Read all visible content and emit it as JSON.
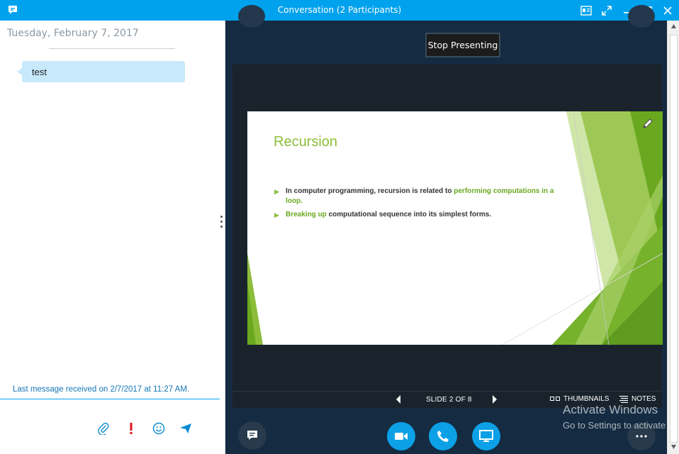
{
  "window": {
    "title": "Conversation (2 Participants)"
  },
  "conversation": {
    "date": "Tuesday, February 7, 2017",
    "messages": [
      {
        "text": "test"
      }
    ],
    "status": "Last message received on 2/7/2017 at 11:27 AM.",
    "compose_value": ""
  },
  "presentation": {
    "stop_label": "Stop Presenting",
    "slide": {
      "title": "Recursion",
      "bullets": [
        {
          "parts": [
            {
              "text": "In computer programming, recursion is related to ",
              "highlight": false
            },
            {
              "text": "performing computations in a loop",
              "highlight": true
            },
            {
              "text": ".",
              "highlight": false
            }
          ]
        },
        {
          "parts": [
            {
              "text": "Breaking up",
              "highlight": true
            },
            {
              "text": " computational sequence into its simplest forms.",
              "highlight": false
            }
          ]
        }
      ]
    },
    "slide_counter": "SLIDE 2 OF 8",
    "thumbnails_label": "THUMBNAILS",
    "notes_label": "NOTES"
  },
  "watermark": {
    "line1": "Activate Windows",
    "line2": "Go to Settings to activate"
  },
  "colors": {
    "titlebar": "#00a2ed",
    "stage": "#142b41",
    "accent_green": "#8cbd3a",
    "message_bubble": "#c7e9fb",
    "call_button": "#0ca0e6"
  },
  "icons": {
    "app": "chat-bubble-icon",
    "attach": "paperclip-icon",
    "important": "exclamation-icon",
    "emoji": "smiley-icon",
    "send": "send-icon",
    "video": "video-camera-icon",
    "call": "phone-icon",
    "present": "monitor-icon",
    "more": "ellipsis-icon",
    "chat": "chat-icon"
  }
}
